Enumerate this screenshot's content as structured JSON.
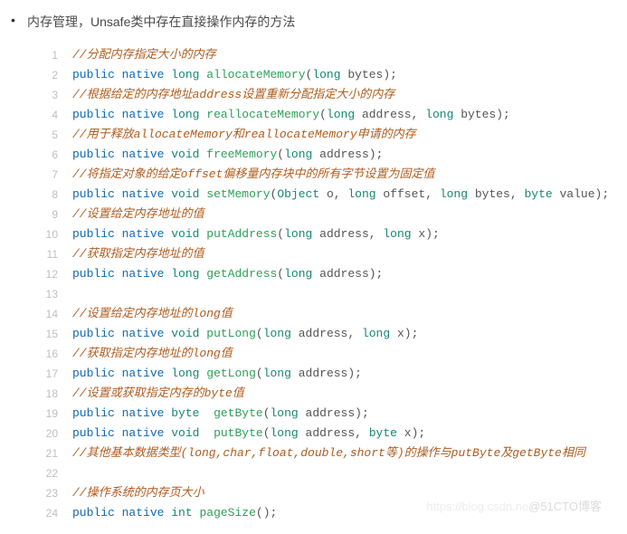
{
  "heading": "内存管理，Unsafe类中存在直接操作内存的方法",
  "watermark_left": "https://blog.csdn.ne",
  "watermark_right": "@51CTO博客",
  "lines": [
    {
      "n": 1,
      "t": [
        {
          "c": "cm",
          "s": "//分配内存指定大小的内存"
        }
      ]
    },
    {
      "n": 2,
      "t": [
        {
          "c": "kw",
          "s": "public"
        },
        {
          "c": "",
          "s": " "
        },
        {
          "c": "kw",
          "s": "native"
        },
        {
          "c": "",
          "s": " "
        },
        {
          "c": "ty",
          "s": "long"
        },
        {
          "c": "",
          "s": " "
        },
        {
          "c": "fn",
          "s": "allocateMemory"
        },
        {
          "c": "punc",
          "s": "("
        },
        {
          "c": "ty",
          "s": "long"
        },
        {
          "c": "",
          "s": " "
        },
        {
          "c": "var",
          "s": "bytes"
        },
        {
          "c": "punc",
          "s": ");"
        }
      ]
    },
    {
      "n": 3,
      "t": [
        {
          "c": "cm",
          "s": "//根据给定的内存地址address设置重新分配指定大小的内存"
        }
      ]
    },
    {
      "n": 4,
      "t": [
        {
          "c": "kw",
          "s": "public"
        },
        {
          "c": "",
          "s": " "
        },
        {
          "c": "kw",
          "s": "native"
        },
        {
          "c": "",
          "s": " "
        },
        {
          "c": "ty",
          "s": "long"
        },
        {
          "c": "",
          "s": " "
        },
        {
          "c": "fn",
          "s": "reallocateMemory"
        },
        {
          "c": "punc",
          "s": "("
        },
        {
          "c": "ty",
          "s": "long"
        },
        {
          "c": "",
          "s": " "
        },
        {
          "c": "var",
          "s": "address"
        },
        {
          "c": "punc",
          "s": ", "
        },
        {
          "c": "ty",
          "s": "long"
        },
        {
          "c": "",
          "s": " "
        },
        {
          "c": "var",
          "s": "bytes"
        },
        {
          "c": "punc",
          "s": ");"
        }
      ]
    },
    {
      "n": 5,
      "t": [
        {
          "c": "cm",
          "s": "//用于释放allocateMemory和reallocateMemory申请的内存"
        }
      ]
    },
    {
      "n": 6,
      "t": [
        {
          "c": "kw",
          "s": "public"
        },
        {
          "c": "",
          "s": " "
        },
        {
          "c": "kw",
          "s": "native"
        },
        {
          "c": "",
          "s": " "
        },
        {
          "c": "ty",
          "s": "void"
        },
        {
          "c": "",
          "s": " "
        },
        {
          "c": "fn",
          "s": "freeMemory"
        },
        {
          "c": "punc",
          "s": "("
        },
        {
          "c": "ty",
          "s": "long"
        },
        {
          "c": "",
          "s": " "
        },
        {
          "c": "var",
          "s": "address"
        },
        {
          "c": "punc",
          "s": ");"
        }
      ]
    },
    {
      "n": 7,
      "t": [
        {
          "c": "cm",
          "s": "//将指定对象的给定offset偏移量内存块中的所有字节设置为固定值"
        }
      ]
    },
    {
      "n": 8,
      "t": [
        {
          "c": "kw",
          "s": "public"
        },
        {
          "c": "",
          "s": " "
        },
        {
          "c": "kw",
          "s": "native"
        },
        {
          "c": "",
          "s": " "
        },
        {
          "c": "ty",
          "s": "void"
        },
        {
          "c": "",
          "s": " "
        },
        {
          "c": "fn",
          "s": "setMemory"
        },
        {
          "c": "punc",
          "s": "("
        },
        {
          "c": "ty",
          "s": "Object"
        },
        {
          "c": "",
          "s": " "
        },
        {
          "c": "var",
          "s": "o"
        },
        {
          "c": "punc",
          "s": ", "
        },
        {
          "c": "ty",
          "s": "long"
        },
        {
          "c": "",
          "s": " "
        },
        {
          "c": "var",
          "s": "offset"
        },
        {
          "c": "punc",
          "s": ", "
        },
        {
          "c": "ty",
          "s": "long"
        },
        {
          "c": "",
          "s": " "
        },
        {
          "c": "var",
          "s": "bytes"
        },
        {
          "c": "punc",
          "s": ", "
        },
        {
          "c": "ty",
          "s": "byte"
        },
        {
          "c": "",
          "s": " "
        },
        {
          "c": "var",
          "s": "value"
        },
        {
          "c": "punc",
          "s": ");"
        }
      ]
    },
    {
      "n": 9,
      "t": [
        {
          "c": "cm",
          "s": "//设置给定内存地址的值"
        }
      ]
    },
    {
      "n": 10,
      "t": [
        {
          "c": "kw",
          "s": "public"
        },
        {
          "c": "",
          "s": " "
        },
        {
          "c": "kw",
          "s": "native"
        },
        {
          "c": "",
          "s": " "
        },
        {
          "c": "ty",
          "s": "void"
        },
        {
          "c": "",
          "s": " "
        },
        {
          "c": "fn",
          "s": "putAddress"
        },
        {
          "c": "punc",
          "s": "("
        },
        {
          "c": "ty",
          "s": "long"
        },
        {
          "c": "",
          "s": " "
        },
        {
          "c": "var",
          "s": "address"
        },
        {
          "c": "punc",
          "s": ", "
        },
        {
          "c": "ty",
          "s": "long"
        },
        {
          "c": "",
          "s": " "
        },
        {
          "c": "var",
          "s": "x"
        },
        {
          "c": "punc",
          "s": ");"
        }
      ]
    },
    {
      "n": 11,
      "t": [
        {
          "c": "cm",
          "s": "//获取指定内存地址的值"
        }
      ]
    },
    {
      "n": 12,
      "t": [
        {
          "c": "kw",
          "s": "public"
        },
        {
          "c": "",
          "s": " "
        },
        {
          "c": "kw",
          "s": "native"
        },
        {
          "c": "",
          "s": " "
        },
        {
          "c": "ty",
          "s": "long"
        },
        {
          "c": "",
          "s": " "
        },
        {
          "c": "fn",
          "s": "getAddress"
        },
        {
          "c": "punc",
          "s": "("
        },
        {
          "c": "ty",
          "s": "long"
        },
        {
          "c": "",
          "s": " "
        },
        {
          "c": "var",
          "s": "address"
        },
        {
          "c": "punc",
          "s": ");"
        }
      ]
    },
    {
      "n": 13,
      "t": []
    },
    {
      "n": 14,
      "t": [
        {
          "c": "cm",
          "s": "//设置给定内存地址的long值"
        }
      ]
    },
    {
      "n": 15,
      "t": [
        {
          "c": "kw",
          "s": "public"
        },
        {
          "c": "",
          "s": " "
        },
        {
          "c": "kw",
          "s": "native"
        },
        {
          "c": "",
          "s": " "
        },
        {
          "c": "ty",
          "s": "void"
        },
        {
          "c": "",
          "s": " "
        },
        {
          "c": "fn",
          "s": "putLong"
        },
        {
          "c": "punc",
          "s": "("
        },
        {
          "c": "ty",
          "s": "long"
        },
        {
          "c": "",
          "s": " "
        },
        {
          "c": "var",
          "s": "address"
        },
        {
          "c": "punc",
          "s": ", "
        },
        {
          "c": "ty",
          "s": "long"
        },
        {
          "c": "",
          "s": " "
        },
        {
          "c": "var",
          "s": "x"
        },
        {
          "c": "punc",
          "s": ");"
        }
      ]
    },
    {
      "n": 16,
      "t": [
        {
          "c": "cm",
          "s": "//获取指定内存地址的long值"
        }
      ]
    },
    {
      "n": 17,
      "t": [
        {
          "c": "kw",
          "s": "public"
        },
        {
          "c": "",
          "s": " "
        },
        {
          "c": "kw",
          "s": "native"
        },
        {
          "c": "",
          "s": " "
        },
        {
          "c": "ty",
          "s": "long"
        },
        {
          "c": "",
          "s": " "
        },
        {
          "c": "fn",
          "s": "getLong"
        },
        {
          "c": "punc",
          "s": "("
        },
        {
          "c": "ty",
          "s": "long"
        },
        {
          "c": "",
          "s": " "
        },
        {
          "c": "var",
          "s": "address"
        },
        {
          "c": "punc",
          "s": ");"
        }
      ]
    },
    {
      "n": 18,
      "t": [
        {
          "c": "cm",
          "s": "//设置或获取指定内存的byte值"
        }
      ]
    },
    {
      "n": 19,
      "t": [
        {
          "c": "kw",
          "s": "public"
        },
        {
          "c": "",
          "s": " "
        },
        {
          "c": "kw",
          "s": "native"
        },
        {
          "c": "",
          "s": " "
        },
        {
          "c": "ty",
          "s": "byte"
        },
        {
          "c": "",
          "s": "  "
        },
        {
          "c": "fn",
          "s": "getByte"
        },
        {
          "c": "punc",
          "s": "("
        },
        {
          "c": "ty",
          "s": "long"
        },
        {
          "c": "",
          "s": " "
        },
        {
          "c": "var",
          "s": "address"
        },
        {
          "c": "punc",
          "s": ");"
        }
      ]
    },
    {
      "n": 20,
      "t": [
        {
          "c": "kw",
          "s": "public"
        },
        {
          "c": "",
          "s": " "
        },
        {
          "c": "kw",
          "s": "native"
        },
        {
          "c": "",
          "s": " "
        },
        {
          "c": "ty",
          "s": "void"
        },
        {
          "c": "",
          "s": "  "
        },
        {
          "c": "fn",
          "s": "putByte"
        },
        {
          "c": "punc",
          "s": "("
        },
        {
          "c": "ty",
          "s": "long"
        },
        {
          "c": "",
          "s": " "
        },
        {
          "c": "var",
          "s": "address"
        },
        {
          "c": "punc",
          "s": ", "
        },
        {
          "c": "ty",
          "s": "byte"
        },
        {
          "c": "",
          "s": " "
        },
        {
          "c": "var",
          "s": "x"
        },
        {
          "c": "punc",
          "s": ");"
        }
      ]
    },
    {
      "n": 21,
      "t": [
        {
          "c": "cm",
          "s": "//其他基本数据类型(long,char,float,double,short等)的操作与putByte及getByte相同"
        }
      ]
    },
    {
      "n": 22,
      "t": []
    },
    {
      "n": 23,
      "t": [
        {
          "c": "cm",
          "s": "//操作系统的内存页大小"
        }
      ]
    },
    {
      "n": 24,
      "t": [
        {
          "c": "kw",
          "s": "public"
        },
        {
          "c": "",
          "s": " "
        },
        {
          "c": "kw",
          "s": "native"
        },
        {
          "c": "",
          "s": " "
        },
        {
          "c": "ty",
          "s": "int"
        },
        {
          "c": "",
          "s": " "
        },
        {
          "c": "fn",
          "s": "pageSize"
        },
        {
          "c": "punc",
          "s": "();"
        }
      ]
    }
  ]
}
